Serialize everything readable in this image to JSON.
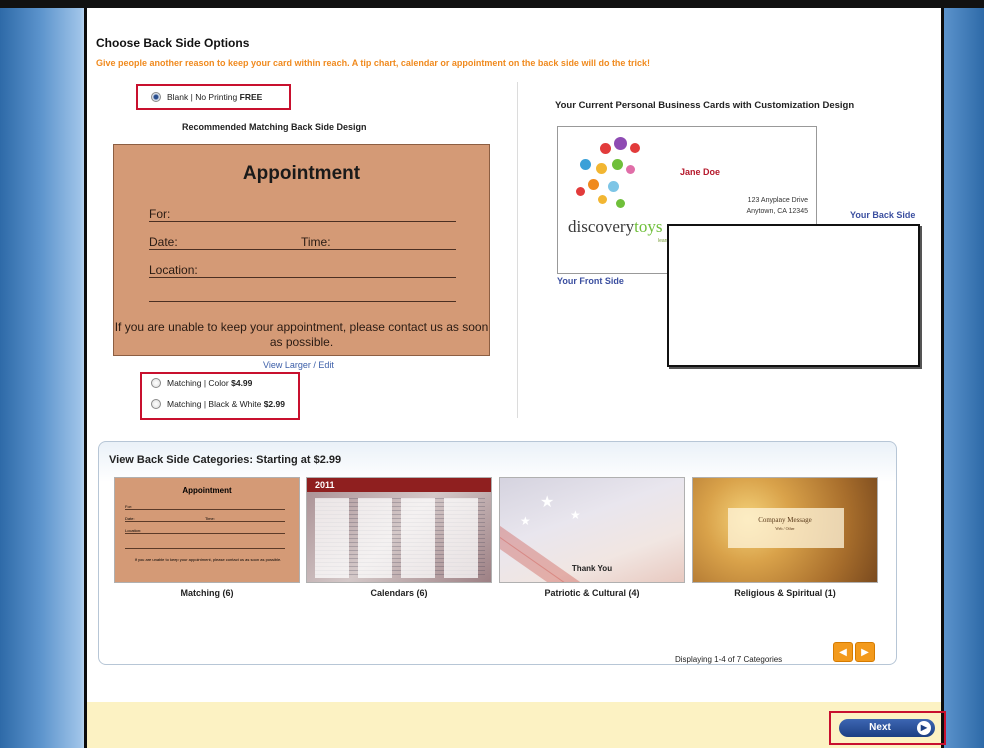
{
  "header": {
    "title": "Choose Back Side Options",
    "subtitle": "Give people another reason to keep your card within reach. A tip chart, calendar or appointment on the back side will do the trick!"
  },
  "options": {
    "blank": {
      "label": "Blank | No Printing",
      "price": "FREE",
      "selected": true
    },
    "matching_color": {
      "label": "Matching | Color",
      "price": "$4.99"
    },
    "matching_bw": {
      "label": "Matching | Black & White",
      "price": "$2.99"
    }
  },
  "recommended": {
    "heading": "Recommended Matching Back Side Design",
    "card": {
      "title": "Appointment",
      "for": "For:",
      "date": "Date:",
      "time": "Time:",
      "location": "Location:",
      "message": "If you are unable to keep your appointment, please contact us as soon as possible."
    },
    "view_larger": "View Larger / Edit"
  },
  "current": {
    "heading": "Your Current Personal Business Cards with Customization Design",
    "front_label": "Your Front Side",
    "back_label": "Your Back Side",
    "front_card": {
      "name": "Jane Doe",
      "address_line1": "123 Anyplace Drive",
      "address_line2": "Anytown, CA 12345",
      "logo_text_1": "discovery",
      "logo_text_2": "toys",
      "logo_tagline": "learn·play·love"
    }
  },
  "categories": {
    "heading": "View Back Side Categories: Starting at $2.99",
    "items": [
      {
        "label": "Matching (6)"
      },
      {
        "label": "Calendars (6)",
        "year": "2011"
      },
      {
        "label": "Patriotic & Cultural (4)",
        "thumb_text": "Thank You"
      },
      {
        "label": "Religious & Spiritual (1)",
        "thumb_text": "Company Message",
        "thumb_sub": "Web / Other"
      }
    ],
    "display_text": "Displaying 1-4 of 7 Categories",
    "thumb_appt": {
      "title": "Appointment",
      "for": "For:",
      "date": "Date:",
      "time": "Time:",
      "location": "Location:",
      "message": "If you are unable to keep your appointment, please contact us as soon as possible."
    }
  },
  "footer": {
    "next_label": "Next"
  },
  "colors": {
    "accent_orange": "#f08a1e",
    "highlight_red": "#c8102e",
    "link_blue": "#3b4fa0",
    "card_tan": "#d49a76"
  }
}
